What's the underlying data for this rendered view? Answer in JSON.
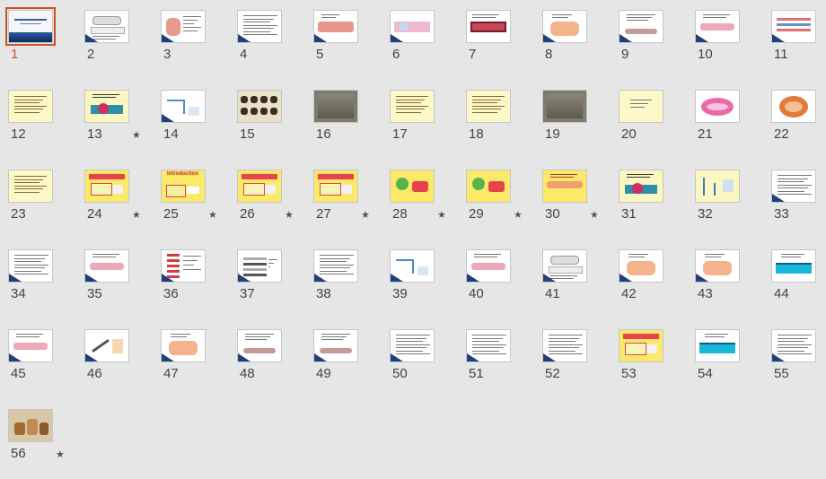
{
  "slides": [
    {
      "number": "1",
      "selected": true,
      "starred": false,
      "style": "title"
    },
    {
      "number": "2",
      "starred": false,
      "style": "diagram-gray"
    },
    {
      "number": "3",
      "starred": false,
      "style": "muscle"
    },
    {
      "number": "4",
      "starred": false,
      "style": "text"
    },
    {
      "number": "5",
      "starred": false,
      "style": "fiber"
    },
    {
      "number": "6",
      "starred": false,
      "style": "fiber-pink"
    },
    {
      "number": "7",
      "starred": false,
      "style": "photo-red"
    },
    {
      "number": "8",
      "starred": false,
      "style": "orange-cell"
    },
    {
      "number": "9",
      "starred": false,
      "style": "text-strip"
    },
    {
      "number": "10",
      "starred": false,
      "style": "pink-strip"
    },
    {
      "number": "11",
      "starred": false,
      "style": "sarcomere"
    },
    {
      "number": "12",
      "starred": false,
      "style": "yellow-text"
    },
    {
      "number": "13",
      "starred": true,
      "style": "yellow-diagram"
    },
    {
      "number": "14",
      "starred": false,
      "style": "blue-diagram"
    },
    {
      "number": "15",
      "starred": false,
      "style": "micro"
    },
    {
      "number": "16",
      "starred": false,
      "style": "photo-gray"
    },
    {
      "number": "17",
      "starred": false,
      "style": "yellow-text"
    },
    {
      "number": "18",
      "starred": false,
      "style": "yellow-text"
    },
    {
      "number": "19",
      "starred": false,
      "style": "photo-gray"
    },
    {
      "number": "20",
      "starred": false,
      "style": "yellow-plain"
    },
    {
      "number": "21",
      "starred": false,
      "style": "mito-pink"
    },
    {
      "number": "22",
      "starred": false,
      "style": "mito-orange"
    },
    {
      "number": "23",
      "starred": false,
      "style": "yellow-text"
    },
    {
      "number": "24",
      "starred": true,
      "style": "yellow-red"
    },
    {
      "number": "25",
      "starred": true,
      "style": "intro"
    },
    {
      "number": "26",
      "starred": true,
      "style": "yellow-red"
    },
    {
      "number": "27",
      "starred": true,
      "style": "yellow-red"
    },
    {
      "number": "28",
      "starred": true,
      "style": "yellow-green"
    },
    {
      "number": "29",
      "starred": true,
      "style": "yellow-green"
    },
    {
      "number": "30",
      "starred": true,
      "style": "yellow-orange"
    },
    {
      "number": "31",
      "starred": false,
      "style": "yellow-diagram"
    },
    {
      "number": "32",
      "starred": false,
      "style": "yellow-blue"
    },
    {
      "number": "33",
      "starred": false,
      "style": "text"
    },
    {
      "number": "34",
      "starred": false,
      "style": "text"
    },
    {
      "number": "35",
      "starred": false,
      "style": "pink-strip"
    },
    {
      "number": "36",
      "starred": false,
      "style": "red-bars"
    },
    {
      "number": "37",
      "starred": false,
      "style": "gray-bands"
    },
    {
      "number": "38",
      "starred": false,
      "style": "text"
    },
    {
      "number": "39",
      "starred": false,
      "style": "blue-diagram"
    },
    {
      "number": "40",
      "starred": false,
      "style": "pink-strip"
    },
    {
      "number": "41",
      "starred": false,
      "style": "diagram-gray"
    },
    {
      "number": "42",
      "starred": false,
      "style": "orange-cell"
    },
    {
      "number": "43",
      "starred": false,
      "style": "orange-cell"
    },
    {
      "number": "44",
      "starred": false,
      "style": "cyan-bar"
    },
    {
      "number": "45",
      "starred": false,
      "style": "pink-strip"
    },
    {
      "number": "46",
      "starred": false,
      "style": "needle"
    },
    {
      "number": "47",
      "starred": false,
      "style": "orange-cell"
    },
    {
      "number": "48",
      "starred": false,
      "style": "text-strip"
    },
    {
      "number": "49",
      "starred": false,
      "style": "text-strip"
    },
    {
      "number": "50",
      "starred": false,
      "style": "text"
    },
    {
      "number": "51",
      "starred": false,
      "style": "text"
    },
    {
      "number": "52",
      "starred": false,
      "style": "text"
    },
    {
      "number": "53",
      "starred": false,
      "style": "yellow-red"
    },
    {
      "number": "54",
      "starred": false,
      "style": "cyan-bar"
    },
    {
      "number": "55",
      "starred": false,
      "style": "text"
    },
    {
      "number": "56",
      "starred": true,
      "style": "photo-brown"
    }
  ],
  "thumb_text": {
    "intro": "Introduction"
  },
  "colors": {
    "accent": "#c8502c",
    "background": "#e6e6e6"
  }
}
